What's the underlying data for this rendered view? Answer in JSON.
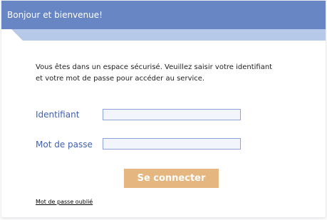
{
  "header": {
    "title": "Bonjour et bienvenue!"
  },
  "intro": {
    "line1": "Vous êtes dans un espace sécurisé. Veuillez saisir votre identifiant",
    "line2": "et votre mot de passe pour accéder au service."
  },
  "form": {
    "id_label": "Identifiant",
    "id_value": "",
    "password_label": "Mot de passe",
    "password_value": "",
    "submit_label": "Se connecter",
    "forgot_link": "Mot de passe oublié"
  }
}
